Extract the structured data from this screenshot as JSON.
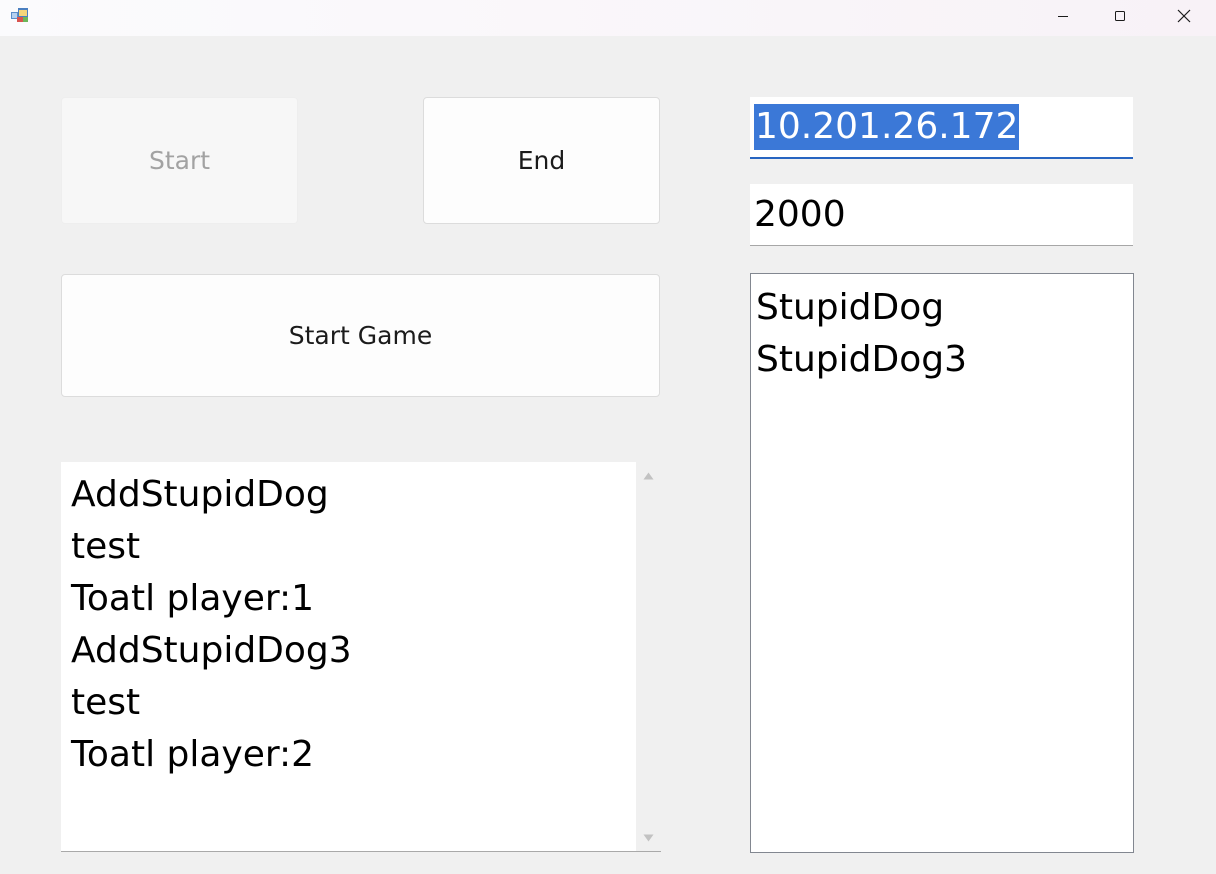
{
  "window": {
    "title": ""
  },
  "buttons": {
    "start_label": "Start",
    "end_label": "End",
    "start_game_label": "Start Game"
  },
  "connection": {
    "ip_value": "10.201.26.172",
    "port_value": "2000"
  },
  "players_list": {
    "items": [
      "StupidDog",
      "StupidDog3"
    ]
  },
  "log": {
    "lines": [
      "AddStupidDog",
      "test",
      "Toatl player:1",
      "AddStupidDog3",
      "test",
      "Toatl player:2"
    ]
  },
  "colors": {
    "selection": "#3b78d7",
    "focus_underline": "#2765c1",
    "background": "#f0f0f0"
  },
  "icons": {
    "app": "app-window-icon",
    "minimize": "minimize-icon",
    "maximize": "maximize-icon",
    "close": "close-icon",
    "scroll_up": "scroll-up-arrow-icon",
    "scroll_down": "scroll-down-arrow-icon"
  }
}
